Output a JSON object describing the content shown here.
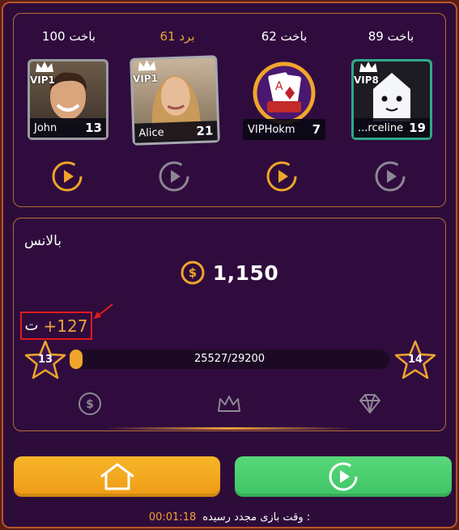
{
  "players": [
    {
      "result": "باخت 100",
      "is_winner": false,
      "name": "John",
      "level": "13",
      "vip": "VIP1"
    },
    {
      "result": "برد 61",
      "is_winner": true,
      "name": "Alice",
      "level": "21",
      "vip": "VIP1"
    },
    {
      "result": "باخت 62",
      "is_winner": false,
      "name": "VIPHokm",
      "level": "7",
      "vip": ""
    },
    {
      "result": "باخت 89",
      "is_winner": false,
      "name": "...rceline",
      "level": "19",
      "vip": "VIP8"
    }
  ],
  "replay_icons": [
    {
      "active": true
    },
    {
      "active": false
    },
    {
      "active": true
    },
    {
      "active": false
    }
  ],
  "balance": {
    "label": "بالانس",
    "coins": "1,150",
    "currency_icon": "dollar-coin-icon"
  },
  "xp": {
    "gain": "+127",
    "unit": "ت"
  },
  "level_progress": {
    "current_level": "13",
    "next_level": "14",
    "text": "25527/29200",
    "fraction": 0.0
  },
  "tabs": [
    {
      "icon": "dollar-icon"
    },
    {
      "icon": "crown-icon"
    },
    {
      "icon": "diamond-icon"
    }
  ],
  "buttons": {
    "home_icon": "home-icon",
    "replay_icon": "replay-icon"
  },
  "footer": {
    "timer": "00:01:18",
    "message": ": وقت بازی مجدد رسیده"
  },
  "colors": {
    "accent_orange": "#f0a52a",
    "accent_green": "#4ccf70",
    "panel_border": "#b36f35",
    "background": "#2e0c3a"
  }
}
